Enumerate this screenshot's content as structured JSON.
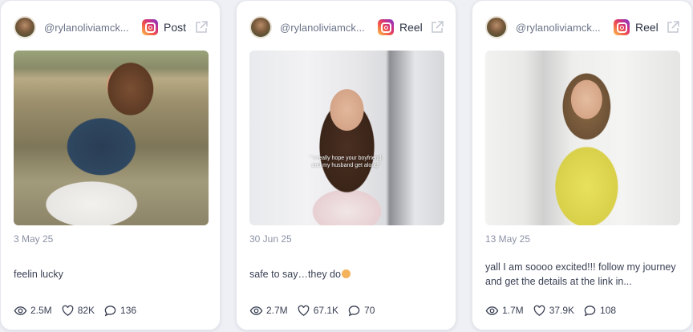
{
  "posts": [
    {
      "handle": "@rylanoliviamck...",
      "type": "Post",
      "date": "3 May 25",
      "caption": "feelin lucky",
      "views": "2.5M",
      "likes": "82K",
      "comments": "136",
      "platform_icon": "instagram-icon"
    },
    {
      "handle": "@rylanoliviamck...",
      "type": "Reel",
      "date": "30 Jun 25",
      "caption": "safe to say…they do",
      "overlay": "\" I really hope your boyfriend and my husband get along\"",
      "views": "2.7M",
      "likes": "67.1K",
      "comments": "70",
      "platform_icon": "instagram-icon"
    },
    {
      "handle": "@rylanoliviamck...",
      "type": "Reel",
      "date": "13 May 25",
      "caption": "yall I am soooo excited!!! follow my journey and get the details at the link in...",
      "views": "1.7M",
      "likes": "37.9K",
      "comments": "108",
      "platform_icon": "instagram-icon"
    }
  ],
  "colors": {
    "background": "#eef0f5",
    "card": "#ffffff",
    "muted_text": "#8b92a5",
    "text": "#2d3446"
  }
}
